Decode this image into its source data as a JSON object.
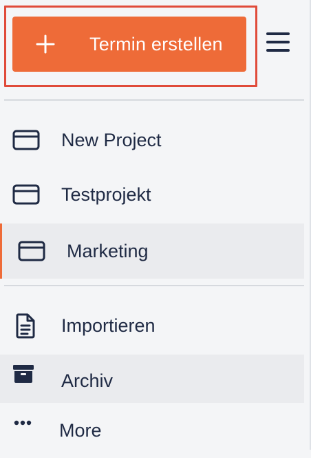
{
  "create_button": {
    "label": "Termin erstellen",
    "icon": "plus-icon",
    "color": "#ee6b38"
  },
  "menu_toggle": {
    "icon": "hamburger-menu-icon"
  },
  "projects": [
    {
      "label": "New Project",
      "icon": "card-icon",
      "active": false
    },
    {
      "label": "Testprojekt",
      "icon": "card-icon",
      "active": false
    },
    {
      "label": "Marketing",
      "icon": "card-icon",
      "active": true
    }
  ],
  "tools": [
    {
      "label": "Importieren",
      "icon": "document-icon"
    },
    {
      "label": "Archiv",
      "icon": "archive-box-icon"
    },
    {
      "label": "More",
      "icon": "more-dots-icon"
    }
  ],
  "colors": {
    "accent": "#ee6b38",
    "highlight_outline": "#e04b3a",
    "text": "#1f2a44",
    "background": "#f4f5f7",
    "active_background": "#eaebee"
  }
}
